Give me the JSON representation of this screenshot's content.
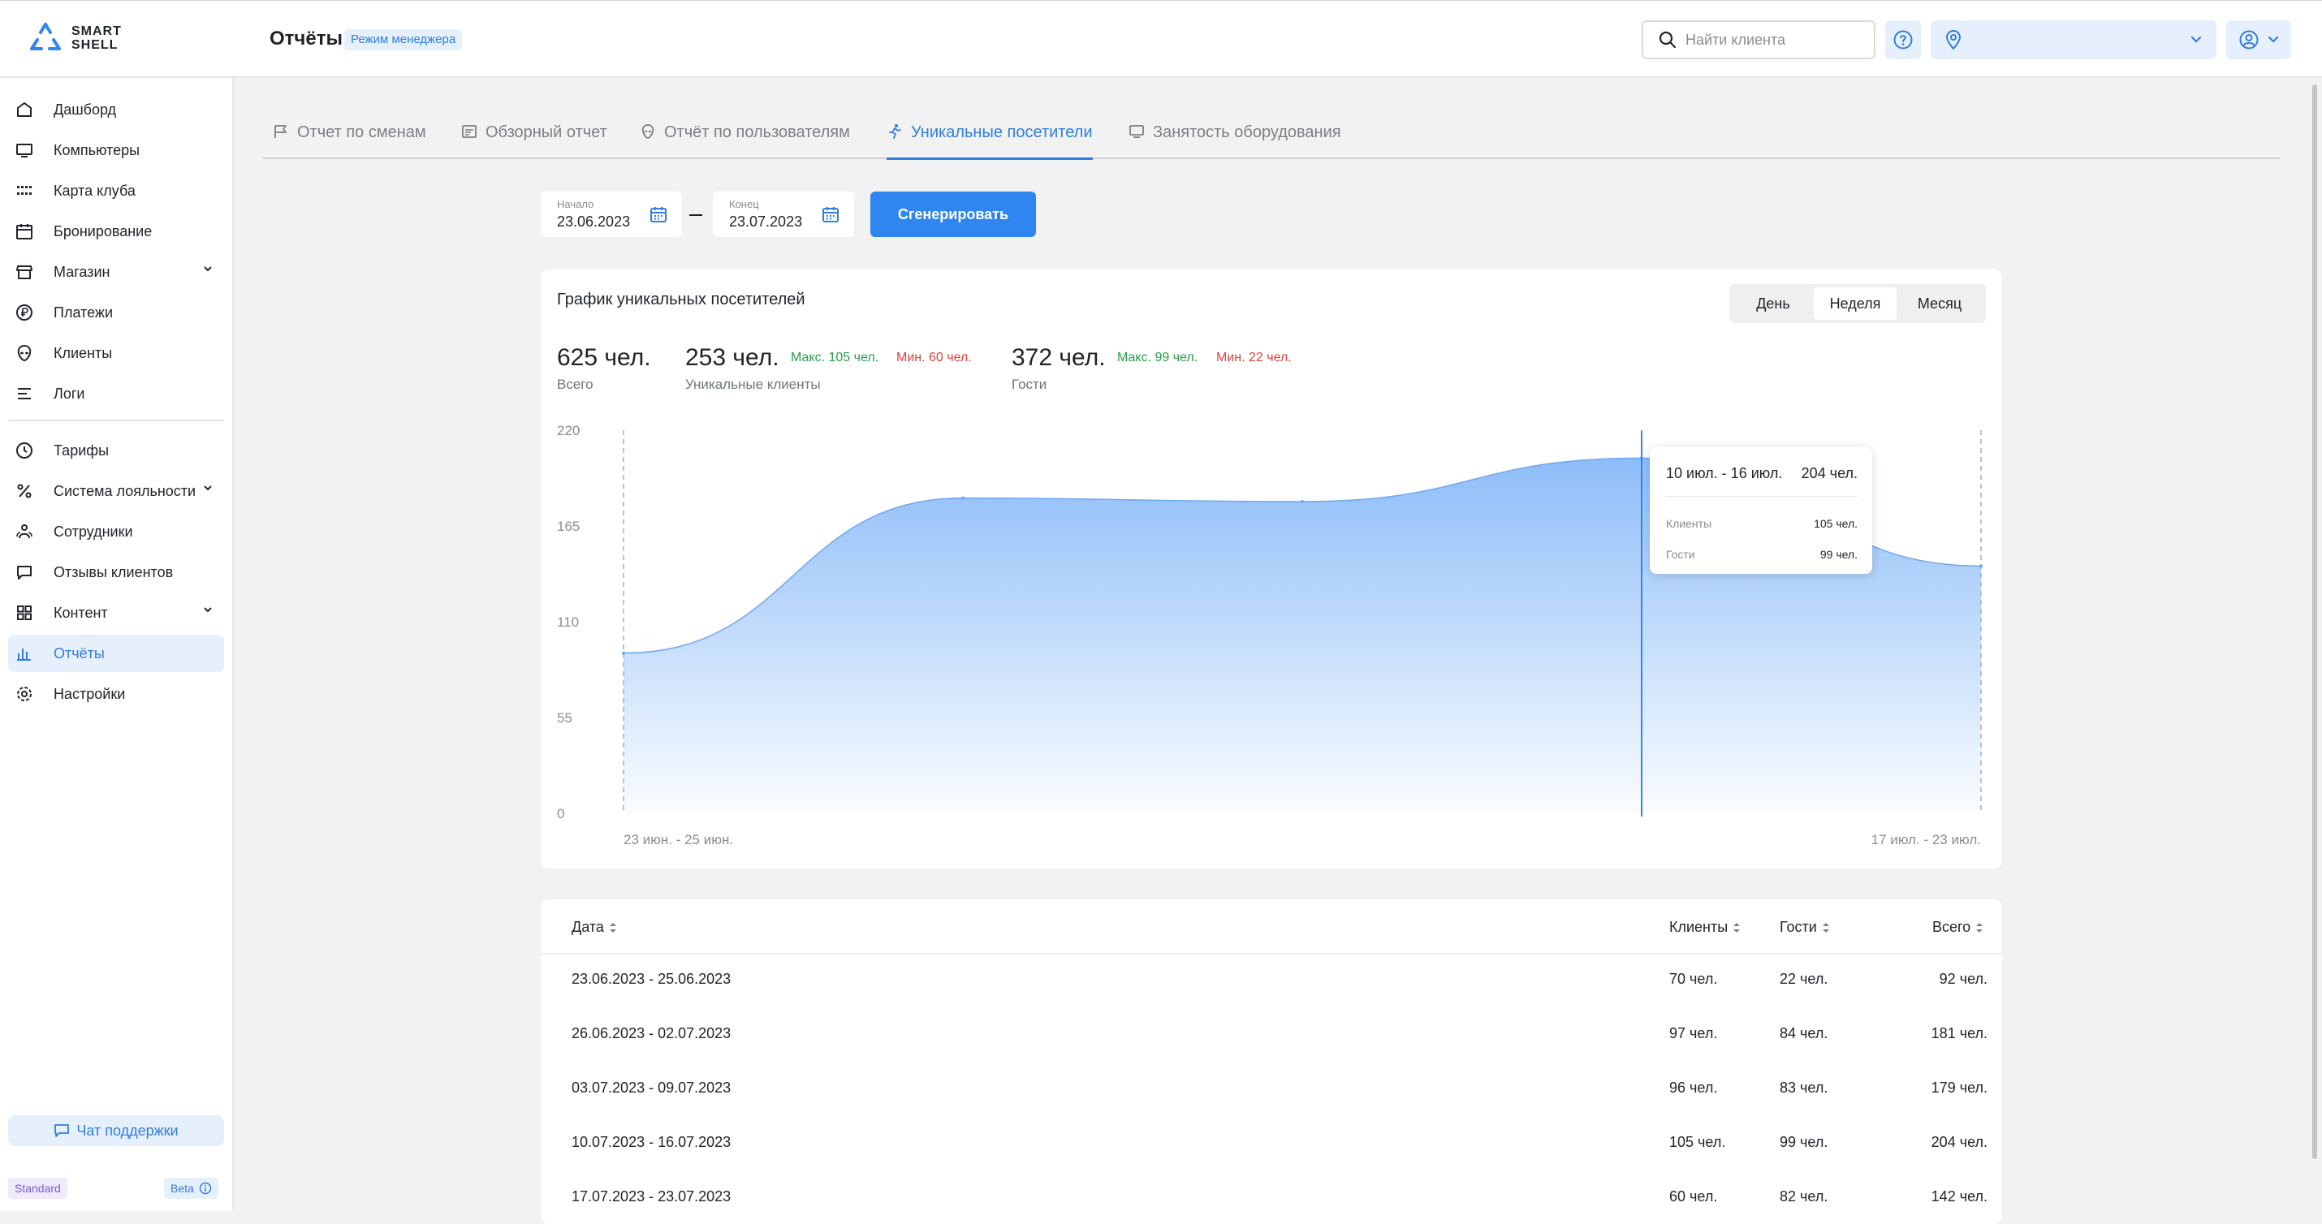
{
  "app": {
    "logo_line1": "SMART",
    "logo_line2": "SHELL"
  },
  "header": {
    "title": "Отчёты",
    "mode_badge": "Режим менеджера",
    "search_placeholder": "Найти клиента",
    "club_select_value": ""
  },
  "sidebar": {
    "items": [
      {
        "label": "Дашборд",
        "icon": "home-icon"
      },
      {
        "label": "Компьютеры",
        "icon": "monitor-icon"
      },
      {
        "label": "Карта клуба",
        "icon": "grid-dots-icon"
      },
      {
        "label": "Бронирование",
        "icon": "calendar-icon"
      },
      {
        "label": "Магазин",
        "icon": "store-icon"
      },
      {
        "label": "Платежи",
        "icon": "coin-icon"
      },
      {
        "label": "Клиенты",
        "icon": "alien-icon"
      },
      {
        "label": "Логи",
        "icon": "list-icon"
      },
      {
        "label": "Тарифы",
        "icon": "clock-icon"
      },
      {
        "label": "Система лояльности",
        "icon": "percent-icon"
      },
      {
        "label": "Сотрудники",
        "icon": "people-icon"
      },
      {
        "label": "Отзывы клиентов",
        "icon": "message-icon"
      },
      {
        "label": "Контент",
        "icon": "apps-icon"
      },
      {
        "label": "Отчёты",
        "icon": "bar-chart-icon"
      },
      {
        "label": "Настройки",
        "icon": "gear-icon"
      }
    ],
    "active_item": "Отчёты",
    "support_label": "Чат поддержки",
    "plan_badge": "Standard",
    "beta_badge": "Beta"
  },
  "tabs": [
    {
      "label": "Отчет по сменам",
      "icon": "flag-icon"
    },
    {
      "label": "Обзорный отчет",
      "icon": "report-icon"
    },
    {
      "label": "Отчёт по пользователям",
      "icon": "alien-icon"
    },
    {
      "label": "Уникальные посетители",
      "icon": "runner-icon"
    },
    {
      "label": "Занятость оборудования",
      "icon": "monitor-icon"
    }
  ],
  "active_tab": "Уникальные посетители",
  "filters": {
    "start_caption": "Начало",
    "start_value": "23.06.2023",
    "end_caption": "Конец",
    "end_value": "23.07.2023",
    "generate_label": "Сгенерировать"
  },
  "chart_card": {
    "title": "График уникальных посетителей",
    "periods": [
      "День",
      "Неделя",
      "Месяц"
    ],
    "active_period": "Неделя",
    "stats": {
      "total_value": "625 чел.",
      "total_caption": "Всего",
      "clients_value": "253 чел.",
      "clients_caption": "Уникальные клиенты",
      "clients_max": "Макс. 105 чел.",
      "clients_min": "Мин. 60 чел.",
      "guests_value": "372 чел.",
      "guests_caption": "Гости",
      "guests_max": "Макс. 99 чел.",
      "guests_min": "Мин. 22 чел."
    },
    "tooltip": {
      "range": "10 июл. - 16 июл.",
      "total": "204 чел.",
      "clients_label": "Клиенты",
      "clients_value": "105 чел.",
      "guests_label": "Гости",
      "guests_value": "99 чел."
    },
    "colors": {
      "accent": "#2f86f0",
      "area_top": "#8dbdf8",
      "max": "#26a046",
      "min": "#e0413a"
    }
  },
  "chart_data": {
    "type": "area",
    "categories": [
      "23 июн. - 25 июн.",
      "26 июн. - 02 июл.",
      "03 июл. - 09 июл.",
      "10 июл. - 16 июл.",
      "17 июл. - 23 июл."
    ],
    "values": [
      92,
      181,
      179,
      204,
      142
    ],
    "x_tick_labels": [
      "23 июн. - 25 июн.",
      "17 июл. - 23 июл."
    ],
    "y_ticks": [
      "220",
      "165",
      "110",
      "55",
      "0"
    ],
    "ylim": [
      0,
      220
    ],
    "highlighted_category": "10 июл. - 16 июл."
  },
  "table": {
    "headers": {
      "date": "Дата",
      "clients": "Клиенты",
      "guests": "Гости",
      "total": "Всего"
    },
    "rows": [
      {
        "date": "23.06.2023 - 25.06.2023",
        "clients": "70 чел.",
        "guests": "22 чел.",
        "total": "92 чел."
      },
      {
        "date": "26.06.2023 - 02.07.2023",
        "clients": "97 чел.",
        "guests": "84 чел.",
        "total": "181 чел."
      },
      {
        "date": "03.07.2023 - 09.07.2023",
        "clients": "96 чел.",
        "guests": "83 чел.",
        "total": "179 чел."
      },
      {
        "date": "10.07.2023 - 16.07.2023",
        "clients": "105 чел.",
        "guests": "99 чел.",
        "total": "204 чел."
      },
      {
        "date": "17.07.2023 - 23.07.2023",
        "clients": "60 чел.",
        "guests": "82 чел.",
        "total": "142 чел."
      }
    ]
  }
}
